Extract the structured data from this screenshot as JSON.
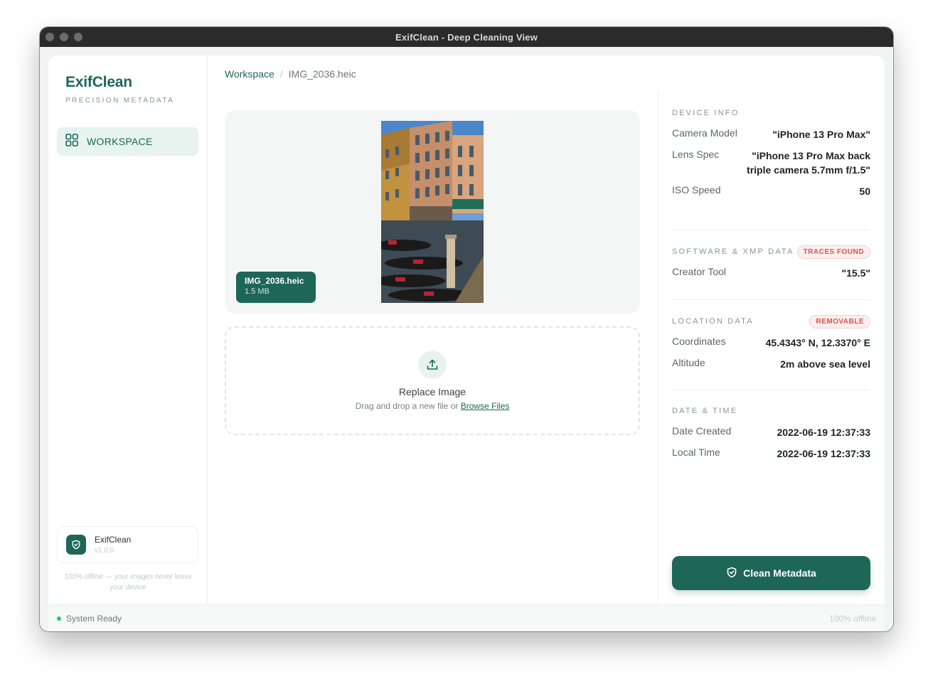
{
  "window": {
    "title": "ExifClean - Deep Cleaning View"
  },
  "sidebar": {
    "brand_title": "ExifClean",
    "brand_subtitle": "PRECISION METADATA",
    "nav": [
      {
        "label": "WORKSPACE",
        "icon": "grid-icon",
        "active": true
      }
    ],
    "app_card": {
      "name": "ExifClean",
      "version": "v1.0.0"
    },
    "offline_note": "100% offline — your images never leave your device"
  },
  "breadcrumb": {
    "root": "Workspace",
    "separator": "/",
    "current": "IMG_2036.heic"
  },
  "preview": {
    "file_name": "IMG_2036.heic",
    "file_size": "1.5 MB"
  },
  "dropzone": {
    "title": "Replace Image",
    "subtitle": "Drag and drop a new file or",
    "browse_link": "Browse Files"
  },
  "metadata": {
    "device": {
      "title": "DEVICE INFO",
      "rows": [
        {
          "key": "Camera Model",
          "value": "\"iPhone 13 Pro Max\""
        },
        {
          "key": "Lens Spec",
          "value": "\"iPhone 13 Pro Max back triple camera 5.7mm f/1.5\""
        },
        {
          "key": "ISO Speed",
          "value": "50"
        }
      ]
    },
    "software": {
      "title": "SOFTWARE & XMP DATA",
      "tag": "TRACES FOUND",
      "rows": [
        {
          "key": "Creator Tool",
          "value": "\"15.5\""
        }
      ]
    },
    "location": {
      "title": "LOCATION DATA",
      "tag": "REMOVABLE",
      "rows": [
        {
          "key": "Coordinates",
          "value": "45.4343° N, 12.3370° E"
        },
        {
          "key": "Altitude",
          "value": "2m above sea level"
        }
      ]
    },
    "datetime": {
      "title": "DATE & TIME",
      "rows": [
        {
          "key": "Date Created",
          "value": "2022-06-19 12:37:33"
        },
        {
          "key": "Local Time",
          "value": "2022-06-19 12:37:33"
        }
      ]
    }
  },
  "action": {
    "clean_label": "Clean Metadata"
  },
  "status": {
    "left": "System Ready",
    "right": "100% offline"
  },
  "colors": {
    "accent": "#1d6658",
    "tag_red": "#d9534f",
    "status_green": "#2bc76b"
  }
}
